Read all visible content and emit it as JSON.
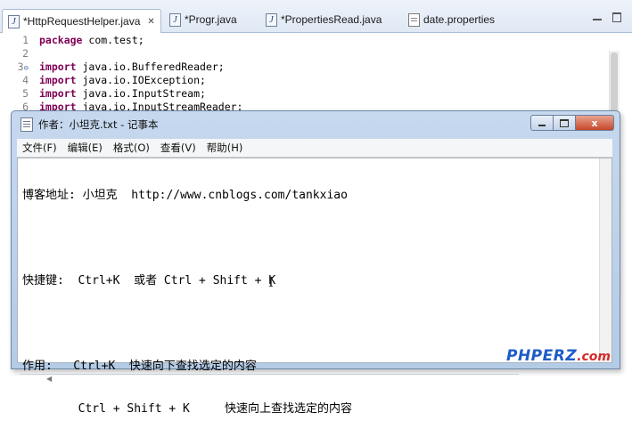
{
  "editor": {
    "tabs": [
      {
        "label": "*HttpRequestHelper.java",
        "icon": "java-file-icon",
        "active": true
      },
      {
        "label": "*Progr.java",
        "icon": "java-file-icon"
      },
      {
        "label": "*PropertiesRead.java",
        "icon": "java-file-icon"
      },
      {
        "label": "date.properties",
        "icon": "properties-file-icon"
      }
    ],
    "lines": [
      {
        "num": "1",
        "kw": "package",
        "rest": " com.test;"
      },
      {
        "num": "2",
        "kw": "",
        "rest": ""
      },
      {
        "num": "3",
        "kw": "import",
        "rest": " java.io.BufferedReader;"
      },
      {
        "num": "4",
        "kw": "import",
        "rest": " java.io.IOException;"
      },
      {
        "num": "5",
        "kw": "import",
        "rest": " java.io.InputStream;"
      },
      {
        "num": "6",
        "kw": "import",
        "rest": " java.io.InputStreamReader;"
      }
    ]
  },
  "notepad": {
    "title": "作者：小坦克.txt - 记事本",
    "menus": [
      "文件(F)",
      "编辑(E)",
      "格式(O)",
      "查看(V)",
      "帮助(H)"
    ],
    "buttons": {
      "close": "x"
    },
    "text_lines": [
      "博客地址: 小坦克  http://www.cnblogs.com/tankxiao",
      "",
      "快捷键:  Ctrl+K  或者 Ctrl + Shift + K",
      "",
      "作用:   Ctrl+K  快速向下查找选定的内容",
      "        Ctrl + Shift + K     快速向上查找选定的内容"
    ]
  },
  "watermark": {
    "main": "PHPERZ",
    "suffix": ".com"
  },
  "colors": {
    "keyword": "#7f0055",
    "watermark_blue": "#1e5cc8",
    "watermark_red": "#d42a2a",
    "close_button": "#c7472b"
  }
}
